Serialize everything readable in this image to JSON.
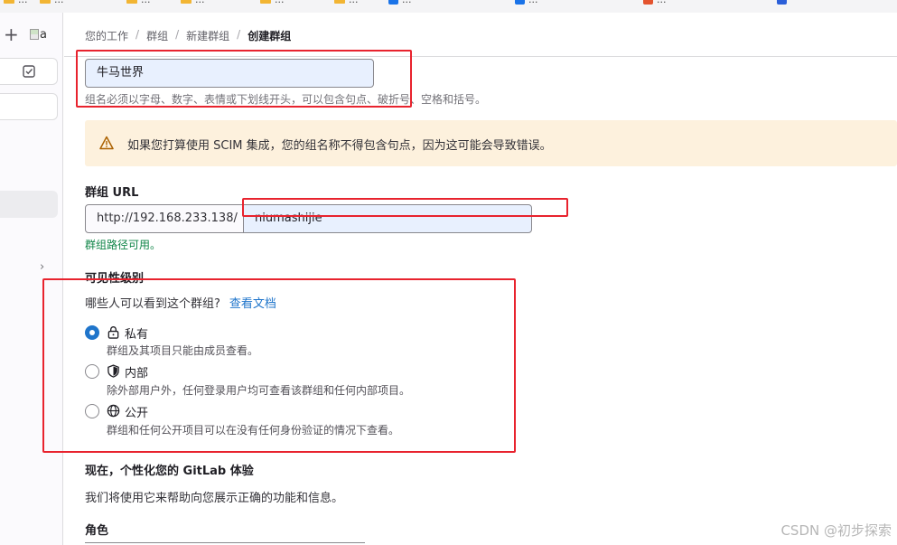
{
  "bookmarks": [
    "...",
    "...",
    "...",
    "...",
    "...",
    "...",
    "...",
    "...",
    "..."
  ],
  "sidebar": {
    "plus_icon": "plus-icon",
    "avatar_alt": "a",
    "todo_icon": "checkbox-icon",
    "chevron": "›"
  },
  "breadcrumb": {
    "items": [
      "您的工作",
      "群组",
      "新建群组",
      "创建群组"
    ],
    "separator": "/"
  },
  "group_name": {
    "value": "牛马世界",
    "hint": "组名必须以字母、数字、表情或下划线开头，可以包含句点、破折号、空格和括号。"
  },
  "alert": {
    "icon": "warning-icon",
    "text": "如果您打算使用 SCIM 集成，您的组名称不得包含句点，因为这可能会导致错误。",
    "color": "#fdf1dd"
  },
  "group_url": {
    "label": "群组 URL",
    "prefix": "http://192.168.233.138/",
    "value": "niumashijie",
    "status": "群组路径可用。"
  },
  "visibility": {
    "label": "可见性级别",
    "question": "哪些人可以看到这个群组?",
    "doc_link": "查看文档",
    "options": [
      {
        "icon": "lock-icon",
        "title": "私有",
        "desc": "群组及其项目只能由成员查看。",
        "checked": true
      },
      {
        "icon": "shield-icon",
        "title": "内部",
        "desc": "除外部用户外，任何登录用户均可查看该群组和任何内部项目。",
        "checked": false
      },
      {
        "icon": "globe-icon",
        "title": "公开",
        "desc": "群组和任何公开项目可以在没有任何身份验证的情况下查看。",
        "checked": false
      }
    ]
  },
  "personalize": {
    "label": "现在，个性化您的 GitLab 体验",
    "desc": "我们将使用它来帮助向您展示正确的功能和信息。"
  },
  "role": {
    "label": "角色"
  },
  "watermark": "CSDN @初步探索",
  "colors": {
    "accent": "#1f75cb",
    "success": "#108548",
    "annotation": "#e8232e"
  }
}
